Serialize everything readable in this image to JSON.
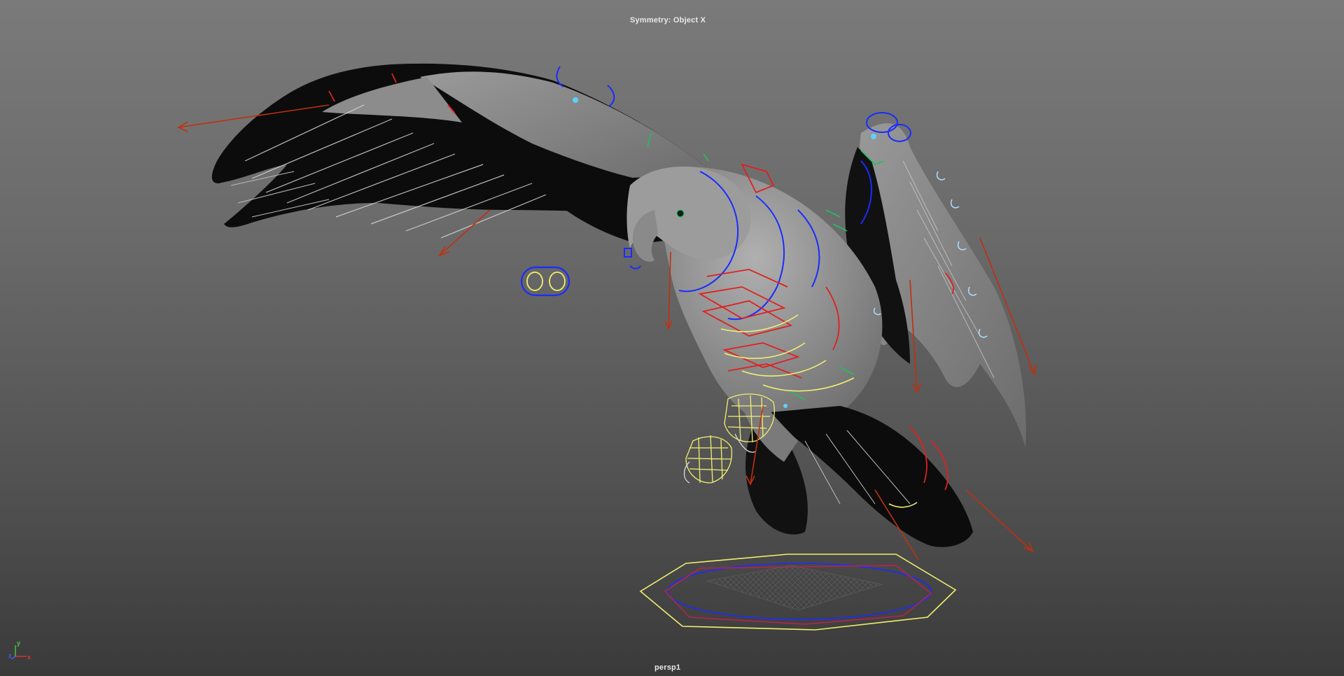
{
  "viewport": {
    "hud_message": "Symmetry: Object X",
    "camera_name": "persp1",
    "background_top": "#7a7a7a",
    "background_bottom": "#3a3a3a"
  },
  "axis_gizmo": {
    "x_label": "x",
    "y_label": "y",
    "z_label": "z",
    "x_color": "#e03030",
    "y_color": "#40d040",
    "z_color": "#4060ff"
  },
  "scene": {
    "model": "eagle-mesh",
    "rig_colors": {
      "ik_controls": "#e02020",
      "fk_controls": "#1a2cff",
      "secondary_controls": "#f0f070",
      "tweak_controls": "#20c060",
      "pivot_markers": "#60d0ff",
      "direction_arrows": "#c03010"
    }
  }
}
